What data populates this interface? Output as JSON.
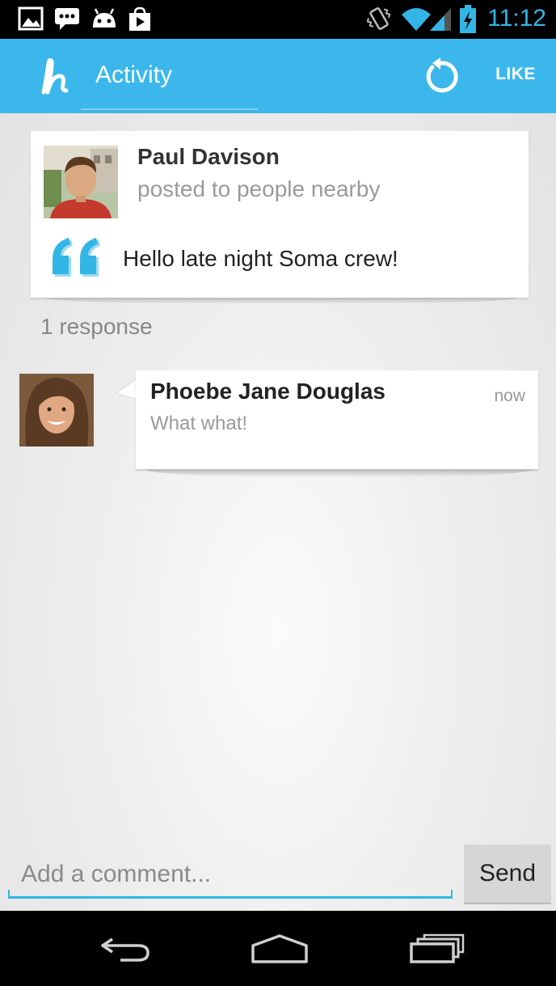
{
  "status_bar": {
    "time": "11:12",
    "accent_color": "#33b5e5",
    "left_icons": [
      "gallery-icon",
      "chat-icon",
      "android-icon",
      "play-store-icon"
    ],
    "right_icons": [
      "vibrate-icon",
      "wifi-icon",
      "signal-icon",
      "battery-charging-icon"
    ]
  },
  "action_bar": {
    "title": "Activity",
    "like_label": "LIKE",
    "logo_icon": "app-logo-h",
    "refresh_icon": "refresh-icon",
    "background_color": "#3bb7ec"
  },
  "post": {
    "author": "Paul Davison",
    "subtitle": "posted to people nearby",
    "message": "Hello late night Soma crew!",
    "quote_color": "#33b5e5"
  },
  "responses_count": "1 response",
  "reply": {
    "author": "Phoebe Jane Douglas",
    "time": "now",
    "text": "What what!"
  },
  "composer": {
    "placeholder": "Add a comment...",
    "value": "",
    "send_label": "Send"
  },
  "nav_bar": {
    "buttons": [
      "back-icon",
      "home-icon",
      "recent-apps-icon"
    ]
  }
}
